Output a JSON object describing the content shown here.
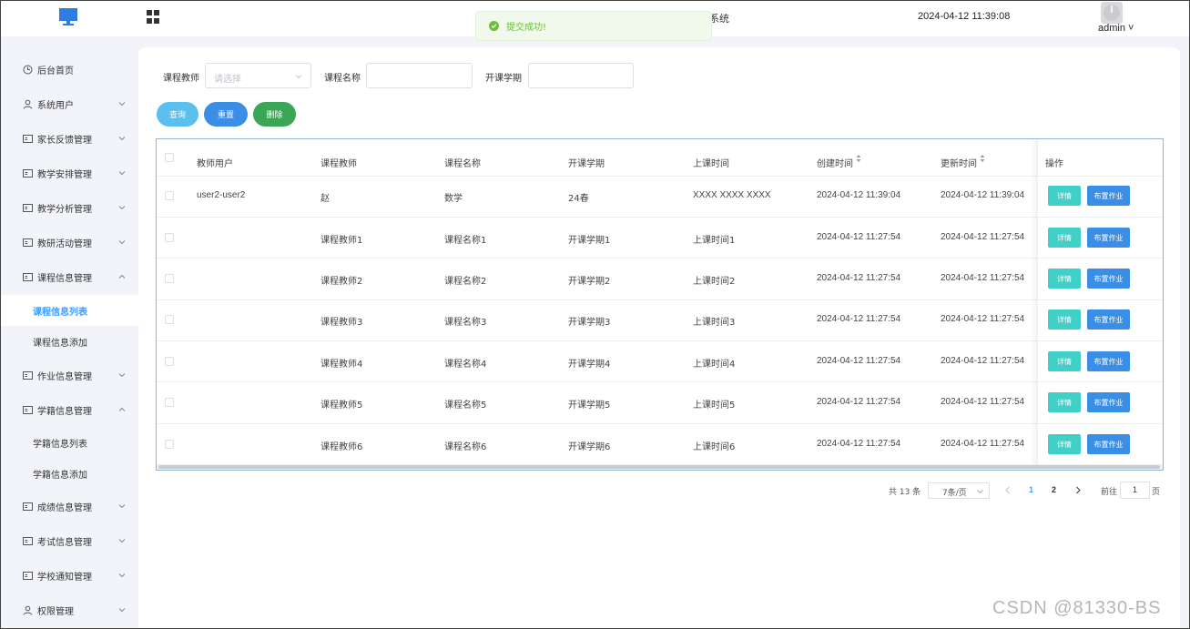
{
  "header": {
    "title_fragment": "系统",
    "datetime": "2024-04-12 11:39:08",
    "user": "admin"
  },
  "toast": {
    "message": "提交成功!",
    "type": "success"
  },
  "sidebar": {
    "items": [
      {
        "label": "后台首页",
        "icon": "clock-icon",
        "arrow": ""
      },
      {
        "label": "系统用户",
        "icon": "user-icon",
        "arrow": "down"
      },
      {
        "label": "家长反馈管理",
        "icon": "card-icon",
        "arrow": "down"
      },
      {
        "label": "教学安排管理",
        "icon": "card-icon",
        "arrow": "down"
      },
      {
        "label": "教学分析管理",
        "icon": "card-icon",
        "arrow": "down"
      },
      {
        "label": "教研活动管理",
        "icon": "card-icon",
        "arrow": "down"
      },
      {
        "label": "课程信息管理",
        "icon": "card-icon",
        "arrow": "up"
      },
      {
        "label": "作业信息管理",
        "icon": "card-icon",
        "arrow": "down"
      },
      {
        "label": "学籍信息管理",
        "icon": "card-icon",
        "arrow": "up"
      },
      {
        "label": "成绩信息管理",
        "icon": "card-icon",
        "arrow": "down"
      },
      {
        "label": "考试信息管理",
        "icon": "card-icon",
        "arrow": "down"
      },
      {
        "label": "学校通知管理",
        "icon": "card-icon",
        "arrow": "down"
      },
      {
        "label": "权限管理",
        "icon": "user-icon",
        "arrow": "down"
      }
    ],
    "sub_course": [
      "课程信息列表",
      "课程信息添加"
    ],
    "sub_student": [
      "学籍信息列表",
      "学籍信息添加"
    ],
    "active": "课程信息列表"
  },
  "filters": {
    "teacher_label": "课程教师",
    "teacher_placeholder": "请选择",
    "course_label": "课程名称",
    "course_value": "",
    "term_label": "开课学期",
    "term_value": ""
  },
  "buttons": {
    "query": "查询",
    "reset": "重置",
    "delete": "删除"
  },
  "table": {
    "columns": [
      "教师用户",
      "课程教师",
      "课程名称",
      "开课学期",
      "上课时间",
      "创建时间",
      "更新时间",
      "操作"
    ],
    "rows": [
      [
        "user2-user2",
        "赵",
        "数学",
        "24春",
        "XXXX XXXX XXXX",
        "2024-04-12 11:39:04",
        "2024-04-12 11:39:04"
      ],
      [
        "",
        "课程教师1",
        "课程名称1",
        "开课学期1",
        "上课时间1",
        "2024-04-12 11:27:54",
        "2024-04-12 11:27:54"
      ],
      [
        "",
        "课程教师2",
        "课程名称2",
        "开课学期2",
        "上课时间2",
        "2024-04-12 11:27:54",
        "2024-04-12 11:27:54"
      ],
      [
        "",
        "课程教师3",
        "课程名称3",
        "开课学期3",
        "上课时间3",
        "2024-04-12 11:27:54",
        "2024-04-12 11:27:54"
      ],
      [
        "",
        "课程教师4",
        "课程名称4",
        "开课学期4",
        "上课时间4",
        "2024-04-12 11:27:54",
        "2024-04-12 11:27:54"
      ],
      [
        "",
        "课程教师5",
        "课程名称5",
        "开课学期5",
        "上课时间5",
        "2024-04-12 11:27:54",
        "2024-04-12 11:27:54"
      ],
      [
        "",
        "课程教师6",
        "课程名称6",
        "开课学期6",
        "上课时间6",
        "2024-04-12 11:27:54",
        "2024-04-12 11:27:54"
      ]
    ],
    "op_detail": "详情",
    "op_assign": "布置作业"
  },
  "pagination": {
    "total": "共 13 条",
    "page_size": "7条/页",
    "pages": [
      "1",
      "2"
    ],
    "current": "1",
    "goto_label": "前往",
    "goto_value": "1",
    "page_suffix": "页"
  },
  "watermark": "CSDN @81330-BS",
  "colors": {
    "query": "#5bc0ee",
    "reset": "#3a8ee6",
    "delete": "#3aa656",
    "detail": "#40d0c8",
    "assign": "#3a8ee6",
    "active_menu": "#409eff",
    "success": "#67c23a"
  }
}
